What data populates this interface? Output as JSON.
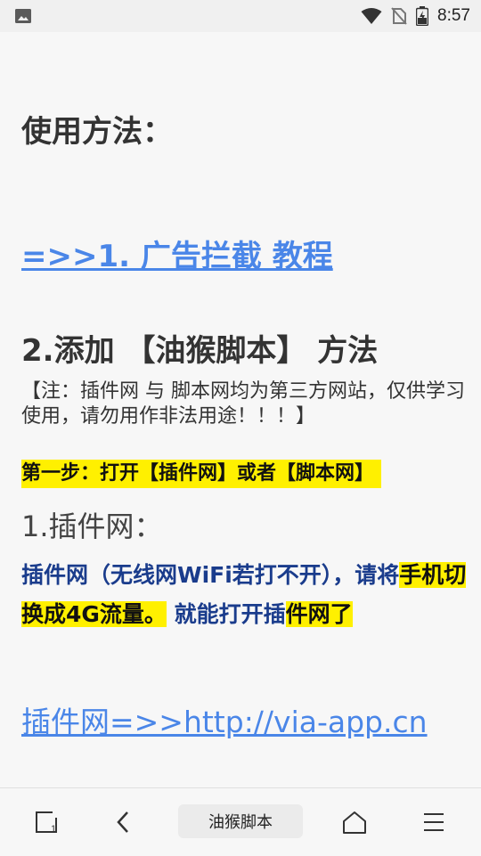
{
  "status_bar": {
    "time": "8:57"
  },
  "content": {
    "usage_heading": "使用方法：",
    "adblock_link": "=>>1. 广告拦截 教程",
    "step2_heading": "2.添加 【油猴脚本】 方法",
    "note": "【注：插件网 与 脚本网均为第三方网站，仅供学习使用，请勿用作非法用途！！！】",
    "step1": "第一步：打开【插件网】或者【脚本网】",
    "plugin_heading": "1.插件网：",
    "hint_part1": "插件网（无线网WiFi若打不开），请将",
    "hint_highlight": "手机切换成4G流量。",
    "hint_part2": " 就能打开插",
    "hint_highlight2": "件网了",
    "plugin_link": "插件网=>>http://via-app.cn"
  },
  "bottom_bar": {
    "title": "油猴脚本",
    "tabs_count": "1"
  }
}
